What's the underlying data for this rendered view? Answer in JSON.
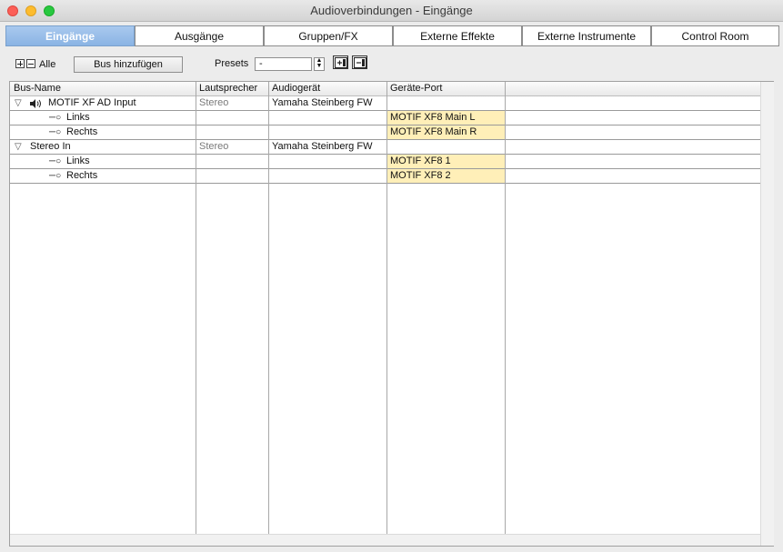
{
  "window": {
    "title": "Audioverbindungen - Eingänge",
    "close_icon": "close-icon",
    "minimize_icon": "minimize-icon",
    "zoom_icon": "zoom-icon"
  },
  "tabs": [
    {
      "label": "Eingänge",
      "active": true
    },
    {
      "label": "Ausgänge",
      "active": false
    },
    {
      "label": "Gruppen/FX",
      "active": false
    },
    {
      "label": "Externe Effekte",
      "active": false
    },
    {
      "label": "Externe Instrumente",
      "active": false
    },
    {
      "label": "Control Room",
      "active": false
    }
  ],
  "toolbar": {
    "all_label": "Alle",
    "add_bus_label": "Bus hinzufügen",
    "presets_label": "Presets",
    "presets_value": "-"
  },
  "columns": [
    "Bus-Name",
    "Lautsprecher",
    "Audiogerät",
    "Geräte-Port"
  ],
  "rows": [
    {
      "type": "bus",
      "name": "MOTIF XF AD Input",
      "speaker": "Stereo",
      "device": "Yamaha Steinberg FW",
      "port": "",
      "icon": "speaker-icon"
    },
    {
      "type": "channel",
      "name": "Links",
      "speaker": "",
      "device": "",
      "port": "MOTIF XF8 Main L"
    },
    {
      "type": "channel",
      "name": "Rechts",
      "speaker": "",
      "device": "",
      "port": "MOTIF XF8 Main R"
    },
    {
      "type": "bus",
      "name": "Stereo In",
      "speaker": "Stereo",
      "device": "Yamaha Steinberg FW",
      "port": ""
    },
    {
      "type": "channel",
      "name": "Links",
      "speaker": "",
      "device": "",
      "port": "MOTIF XF8 1"
    },
    {
      "type": "channel",
      "name": "Rechts",
      "speaker": "",
      "device": "",
      "port": "MOTIF XF8 2"
    }
  ],
  "colors": {
    "active_tab": "#8ab4e4",
    "port_highlight": "#ffefb8"
  }
}
